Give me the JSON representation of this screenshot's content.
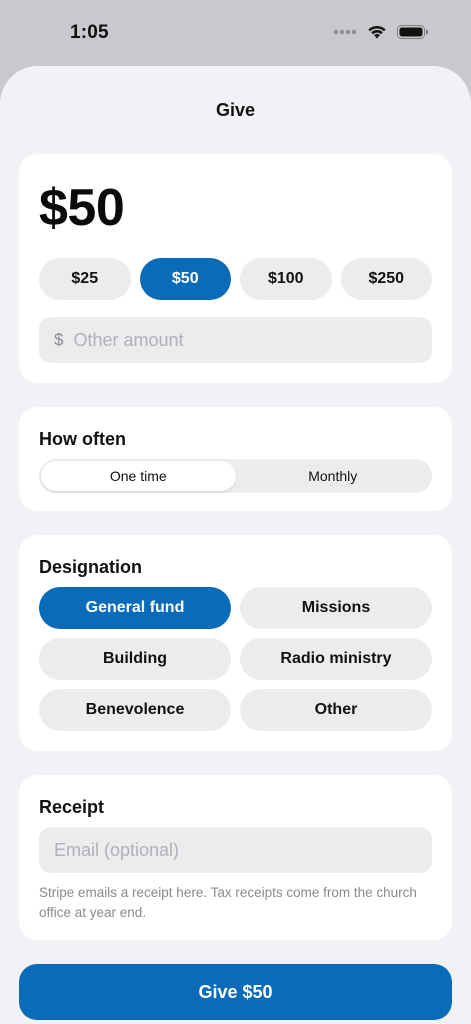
{
  "status": {
    "time": "1:05"
  },
  "sheet": {
    "title": "Give"
  },
  "amount": {
    "display": "$50",
    "presets": [
      {
        "label": "$25",
        "selected": false
      },
      {
        "label": "$50",
        "selected": true
      },
      {
        "label": "$100",
        "selected": false
      },
      {
        "label": "$250",
        "selected": false
      }
    ],
    "other": {
      "currency": "$",
      "placeholder": "Other amount",
      "value": ""
    }
  },
  "frequency": {
    "label": "How often",
    "options": [
      {
        "label": "One time",
        "selected": true
      },
      {
        "label": "Monthly",
        "selected": false
      }
    ]
  },
  "designation": {
    "label": "Designation",
    "options": [
      {
        "label": "General fund",
        "selected": true
      },
      {
        "label": "Missions",
        "selected": false
      },
      {
        "label": "Building",
        "selected": false
      },
      {
        "label": "Radio ministry",
        "selected": false
      },
      {
        "label": "Benevolence",
        "selected": false
      },
      {
        "label": "Other",
        "selected": false
      }
    ]
  },
  "receipt": {
    "label": "Receipt",
    "email_placeholder": "Email (optional)",
    "email_value": "",
    "note": "Stripe emails a receipt here. Tax receipts come from the church office at year end."
  },
  "submit": {
    "label": "Give $50"
  },
  "colors": {
    "accent": "#0a6cb8",
    "pill_bg": "#ececee",
    "sheet_bg": "#f2f2f6"
  }
}
